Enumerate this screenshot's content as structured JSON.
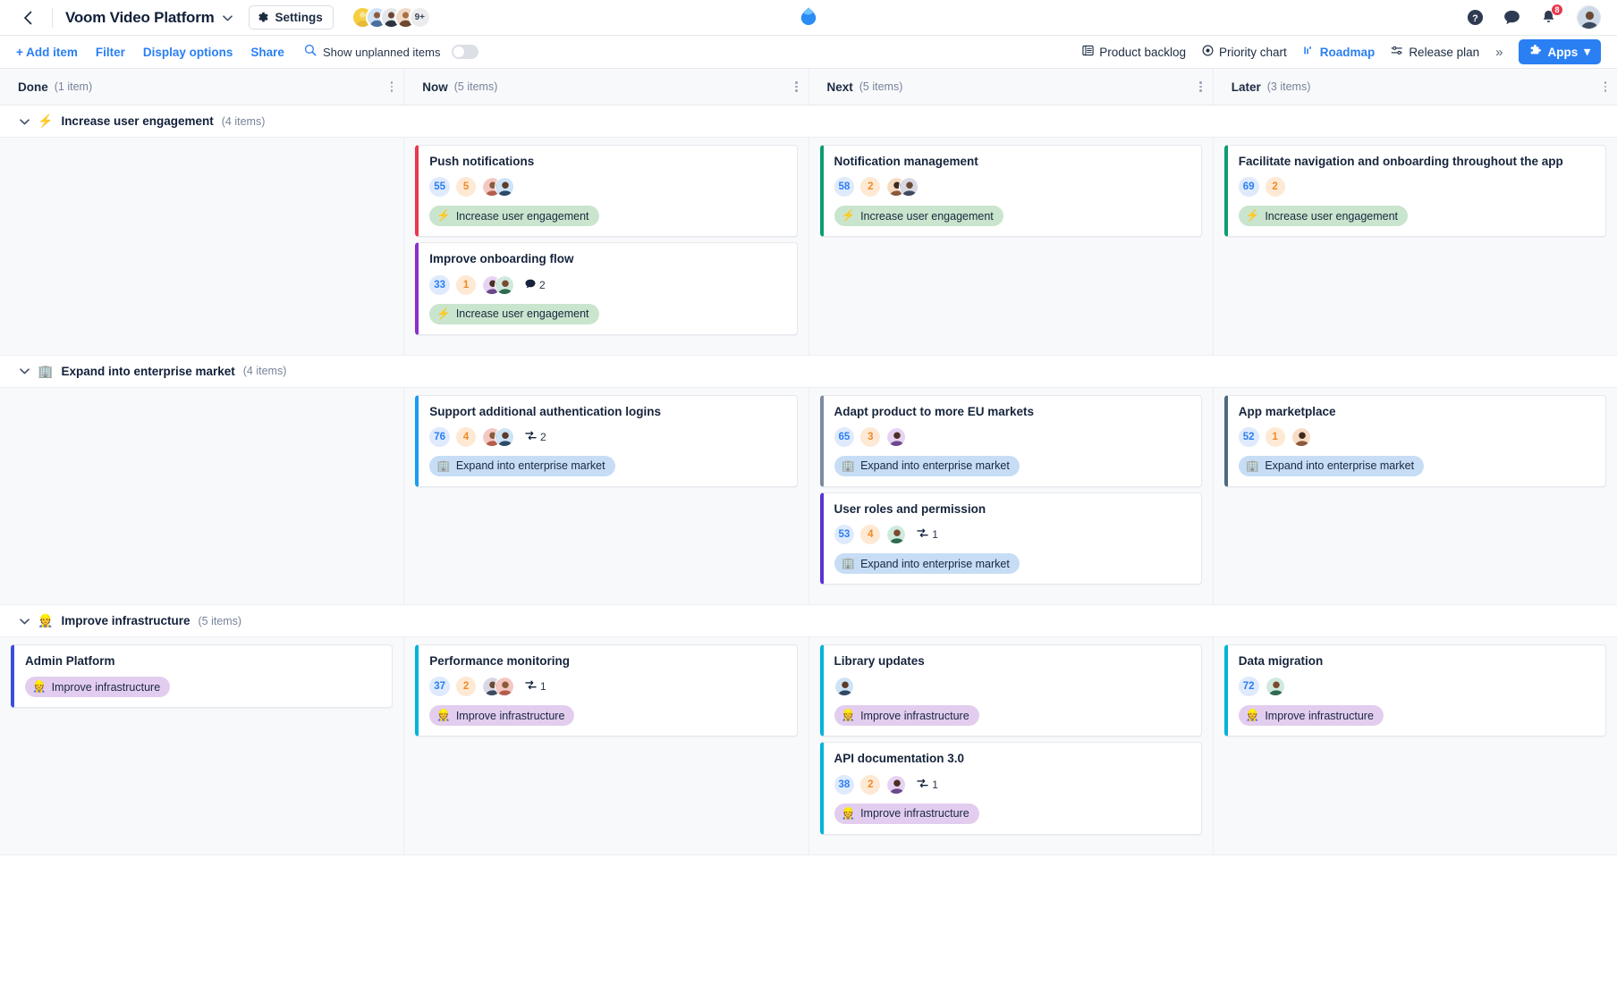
{
  "header": {
    "back_icon": "chevron-left-icon",
    "project_title": "Voom Video Platform",
    "project_dropdown_icon": "chevron-down-icon",
    "settings_label": "Settings",
    "settings_icon": "gear-icon",
    "collaborators_overflow": "9+",
    "logo_icon": "app-logo-icon",
    "help_icon": "help-circle-icon",
    "chat_icon": "chat-bubble-icon",
    "bell_icon": "bell-icon",
    "notification_count": "8",
    "user_avatar_icon": "avatar"
  },
  "toolbar": {
    "add_item_label": "+ Add item",
    "filter_label": "Filter",
    "display_options_label": "Display options",
    "share_label": "Share",
    "search_icon": "search-icon",
    "unplanned_label": "Show unplanned items",
    "unplanned_toggle_state": "off",
    "views": [
      {
        "label": "Product backlog",
        "icon": "backlog-icon",
        "active": false
      },
      {
        "label": "Priority chart",
        "icon": "target-icon",
        "active": false
      },
      {
        "label": "Roadmap",
        "icon": "roadmap-icon",
        "active": true
      },
      {
        "label": "Release plan",
        "icon": "release-plan-icon",
        "active": false
      }
    ],
    "more_views_icon": "chevron-double-right-icon",
    "apps_label": "Apps",
    "apps_icon": "puzzle-icon",
    "apps_caret": "▾",
    "accent_color": "#2a7ff3"
  },
  "columns": [
    {
      "name": "Done",
      "count": "(1 item)"
    },
    {
      "name": "Now",
      "count": "(5 items)"
    },
    {
      "name": "Next",
      "count": "(5 items)"
    },
    {
      "name": "Later",
      "count": "(3 items)"
    }
  ],
  "lanes": [
    {
      "emoji": "⚡",
      "title": "Increase user engagement",
      "count": "(4 items)",
      "chevron": "chevron-down-icon",
      "goal_class": "goal-engagement",
      "columns": [
        {
          "cards": []
        },
        {
          "cards": [
            {
              "title": "Push notifications",
              "score": "55",
              "effort": "5",
              "avatars": 2,
              "links": null,
              "comments": null,
              "goal": "Increase user engagement",
              "border": "#e8384f"
            },
            {
              "title": "Improve onboarding flow",
              "score": "33",
              "effort": "1",
              "avatars": 2,
              "links": null,
              "comments": "2",
              "goal": "Increase user engagement",
              "border": "#8b2fc9"
            }
          ]
        },
        {
          "cards": [
            {
              "title": "Notification management",
              "score": "58",
              "effort": "2",
              "avatars": 2,
              "links": null,
              "comments": null,
              "goal": "Increase user engagement",
              "border": "#0d9b73"
            }
          ]
        },
        {
          "cards": [
            {
              "title": "Facilitate navigation and onboarding throughout the app",
              "score": "69",
              "effort": "2",
              "avatars": 0,
              "links": null,
              "comments": null,
              "goal": "Increase user engagement",
              "border": "#0d9b73"
            }
          ]
        }
      ]
    },
    {
      "emoji": "🏢",
      "title": "Expand into enterprise market",
      "count": "(4 items)",
      "chevron": "chevron-down-icon",
      "goal_class": "goal-enterprise",
      "columns": [
        {
          "cards": []
        },
        {
          "cards": [
            {
              "title": "Support additional authentication logins",
              "score": "76",
              "effort": "4",
              "avatars": 2,
              "links": "2",
              "comments": null,
              "goal": "Expand into enterprise market",
              "border": "#1a9bf0"
            }
          ]
        },
        {
          "cards": [
            {
              "title": "Adapt product to more EU markets",
              "score": "65",
              "effort": "3",
              "avatars": 1,
              "links": null,
              "comments": null,
              "goal": "Expand into enterprise market",
              "border": "#7e8a9e"
            },
            {
              "title": "User roles and permission",
              "score": "53",
              "effort": "4",
              "avatars": 1,
              "links": "1",
              "comments": null,
              "goal": "Expand into enterprise market",
              "border": "#5b32d6"
            }
          ]
        },
        {
          "cards": [
            {
              "title": "App marketplace",
              "score": "52",
              "effort": "1",
              "avatars": 1,
              "links": null,
              "comments": null,
              "goal": "Expand into enterprise market",
              "border": "#4c6b80"
            }
          ]
        }
      ]
    },
    {
      "emoji": "👷",
      "title": "Improve infrastructure",
      "count": "(5 items)",
      "chevron": "chevron-down-icon",
      "goal_class": "goal-infra",
      "columns": [
        {
          "cards": [
            {
              "title": "Admin Platform",
              "score": null,
              "effort": null,
              "avatars": 0,
              "links": null,
              "comments": null,
              "goal": "Improve infrastructure",
              "border": "#3b4fd8"
            }
          ]
        },
        {
          "cards": [
            {
              "title": "Performance monitoring",
              "score": "37",
              "effort": "2",
              "avatars": 2,
              "links": "1",
              "comments": null,
              "goal": "Improve infrastructure",
              "border": "#00b4d8"
            }
          ]
        },
        {
          "cards": [
            {
              "title": "Library updates",
              "score": null,
              "effort": null,
              "avatars": 1,
              "links": null,
              "comments": null,
              "goal": "Improve infrastructure",
              "border": "#00b4d8"
            },
            {
              "title": "API documentation 3.0",
              "score": "38",
              "effort": "2",
              "avatars": 1,
              "links": "1",
              "comments": null,
              "goal": "Improve infrastructure",
              "border": "#00b4d8"
            }
          ]
        },
        {
          "cards": [
            {
              "title": "Data migration",
              "score": "72",
              "effort": null,
              "avatars": 1,
              "links": null,
              "comments": null,
              "goal": "Improve infrastructure",
              "border": "#00b4d8"
            }
          ]
        }
      ]
    }
  ]
}
